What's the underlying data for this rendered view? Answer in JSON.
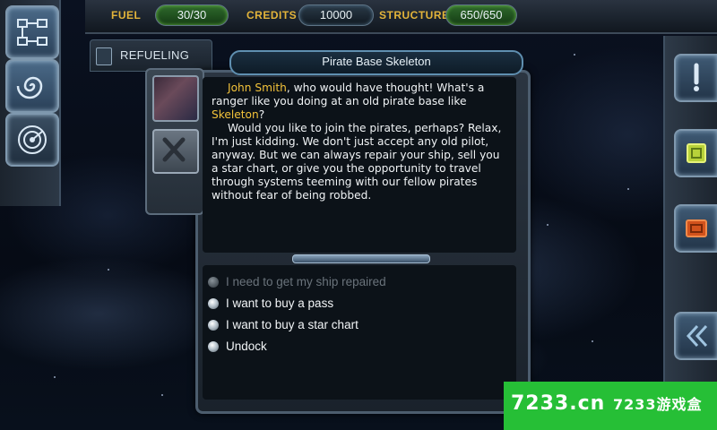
{
  "hud": {
    "fuel_label": "FUEL",
    "fuel_value": "30/30",
    "credits_label": "CREDITS",
    "credits_value": "10000",
    "structure_label": "STRUCTURE",
    "structure_value": "650/650",
    "accent_color": "#e3b43a",
    "pill_green": "#2f6a2c"
  },
  "tab": {
    "label": "REFUELING"
  },
  "dialog": {
    "title": "Pirate Base Skeleton",
    "speaker": "John Smith",
    "line1_rest": ", who would have thought! What's a ranger like you doing at an old pirate base like",
    "base_name": "Skeleton",
    "line1_end": "?",
    "paragraph2": "Would you like to join the pirates, perhaps? Relax, I'm just kidding. We don't just accept any old pilot, anyway. But we can always repair your ship, sell you a star chart, or give you the opportunity to travel through systems teeming with our fellow pirates without fear of being robbed.",
    "highlight_color": "#f2c23a"
  },
  "options": [
    {
      "label": "I need to get my ship repaired",
      "enabled": false
    },
    {
      "label": "I want to buy a pass",
      "enabled": true
    },
    {
      "label": "I want to buy a star chart",
      "enabled": true
    },
    {
      "label": "Undock",
      "enabled": true
    }
  ],
  "icons": {
    "left": [
      "network-map-icon",
      "galaxy-spiral-icon",
      "radar-icon"
    ],
    "right": [
      "alert-exclamation-icon",
      "chip-icon",
      "cargo-icon",
      "back-chevrons-icon"
    ],
    "portrait": "character-portrait",
    "close": "close-x-icon"
  },
  "watermark": {
    "text_a": "7233.cn",
    "text_b": "7233游戏盒",
    "color": "#26bf36"
  }
}
